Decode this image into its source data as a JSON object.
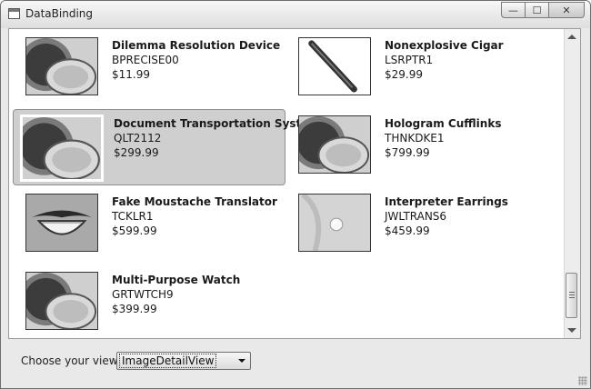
{
  "window": {
    "title": "DataBinding",
    "min_glyph": "—",
    "max_glyph": "☐",
    "close_glyph": "✕"
  },
  "products": [
    {
      "name": "Dilemma Resolution Device",
      "code": "BPRECISE00",
      "price": "$11.99",
      "image": "compact-mirror",
      "selected": false
    },
    {
      "name": "Nonexplosive Cigar",
      "code": "LSRPTR1",
      "price": "$29.99",
      "image": "cigar",
      "selected": false
    },
    {
      "name": "Document Transportation System",
      "code": "QLT2112",
      "price": "$299.99",
      "image": "compact-mirror",
      "selected": true
    },
    {
      "name": "Hologram Cufflinks",
      "code": "THNKDKE1",
      "price": "$799.99",
      "image": "compact-mirror",
      "selected": false
    },
    {
      "name": "Fake Moustache Translator",
      "code": "TCKLR1",
      "price": "$599.99",
      "image": "moustache-smile",
      "selected": false
    },
    {
      "name": "Interpreter Earrings",
      "code": "JWLTRANS6",
      "price": "$459.99",
      "image": "earring",
      "selected": false
    },
    {
      "name": "Multi-Purpose Watch",
      "code": "GRTWTCH9",
      "price": "$399.99",
      "image": "compact-mirror",
      "selected": false
    }
  ],
  "footer": {
    "view_label": "Choose your view:",
    "view_value": "ImageDetailView"
  }
}
